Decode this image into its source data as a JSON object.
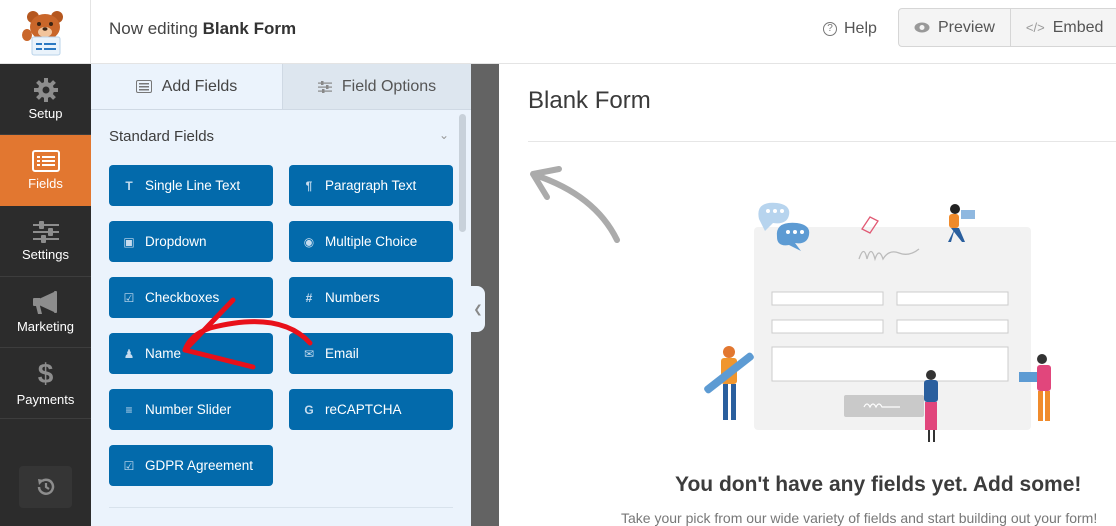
{
  "header": {
    "logo_alt": "WPForms bear mascot",
    "title_prefix": "Now editing",
    "title_form": "Blank Form",
    "help_label": "Help",
    "preview_label": "Preview",
    "embed_label": "Embed"
  },
  "leftnav": {
    "items": [
      {
        "label": "Setup",
        "icon": "gear-icon",
        "active": false
      },
      {
        "label": "Fields",
        "icon": "fields-list-icon",
        "active": true
      },
      {
        "label": "Settings",
        "icon": "sliders-icon",
        "active": false
      },
      {
        "label": "Marketing",
        "icon": "megaphone-icon",
        "active": false
      },
      {
        "label": "Payments",
        "icon": "dollar-icon",
        "active": false
      }
    ],
    "revisions_icon": "history-icon",
    "active_color": "#e27730"
  },
  "panel": {
    "tabs": [
      {
        "label": "Add Fields",
        "icon": "list-icon",
        "active": true
      },
      {
        "label": "Field Options",
        "icon": "sliders-icon",
        "active": false
      }
    ],
    "section_title": "Standard Fields",
    "fields": [
      {
        "label": "Single Line Text",
        "icon": "text-icon"
      },
      {
        "label": "Paragraph Text",
        "icon": "paragraph-icon"
      },
      {
        "label": "Dropdown",
        "icon": "dropdown-icon"
      },
      {
        "label": "Multiple Choice",
        "icon": "radio-icon"
      },
      {
        "label": "Checkboxes",
        "icon": "checkbox-icon"
      },
      {
        "label": "Numbers",
        "icon": "hash-icon"
      },
      {
        "label": "Name",
        "icon": "user-icon"
      },
      {
        "label": "Email",
        "icon": "envelope-icon"
      },
      {
        "label": "Number Slider",
        "icon": "sliders-icon"
      },
      {
        "label": "reCAPTCHA",
        "icon": "google-icon"
      },
      {
        "label": "GDPR Agreement",
        "icon": "checkbox-icon"
      }
    ],
    "button_color": "#036aab"
  },
  "preview": {
    "form_title": "Blank Form",
    "empty_heading": "You don't have any fields yet. Add some!",
    "empty_text": "Take your pick from our wide variety of fields and start building out your form!"
  },
  "annotations": {
    "red_arrow": "arrow pointing to Name field",
    "gray_arrow": "arrow pointing to field panel"
  }
}
